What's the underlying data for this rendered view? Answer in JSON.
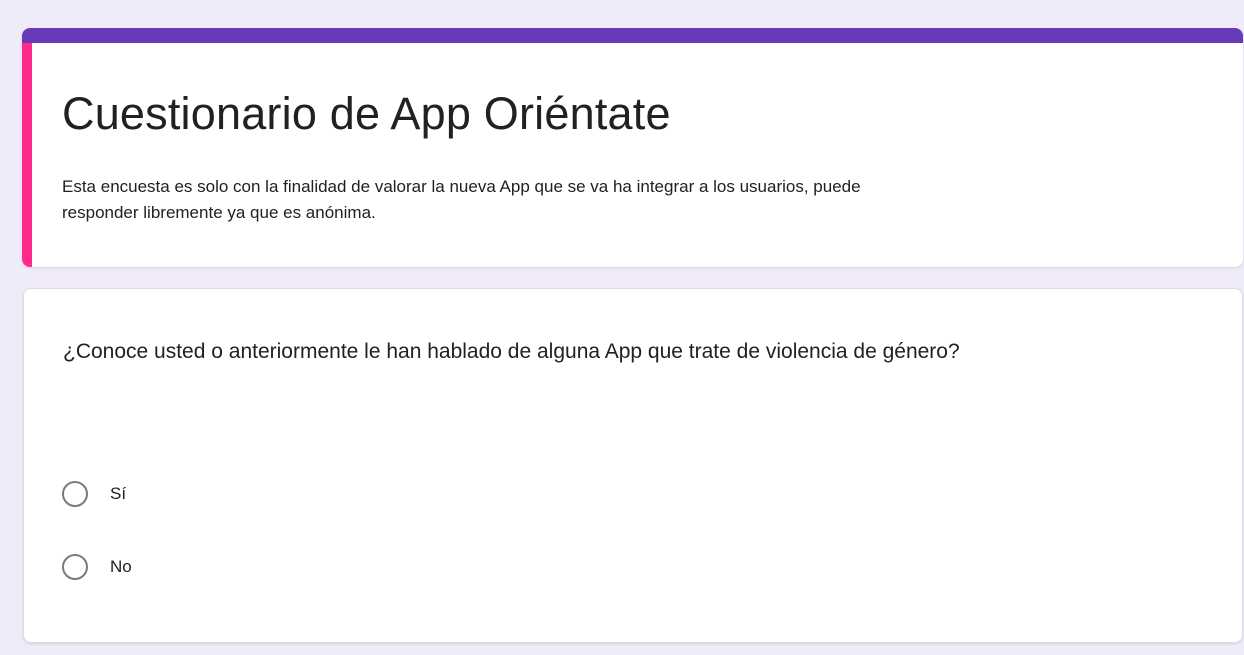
{
  "form": {
    "title": "Cuestionario de App Oriéntate",
    "description": "Esta encuesta es solo con la finalidad de valorar la nueva App que se va ha integrar a los usuarios, puede\nresponder libremente ya que es anónima.",
    "colors": {
      "background": "#f0ebf8",
      "accent_top": "#673ab7",
      "accent_left": "#ff2a8a"
    }
  },
  "question": {
    "text": "¿Conoce usted o anteriormente le han hablado de alguna App que trate de violencia de género?",
    "options": [
      {
        "label": "Sí",
        "selected": false
      },
      {
        "label": "No",
        "selected": false
      }
    ]
  }
}
